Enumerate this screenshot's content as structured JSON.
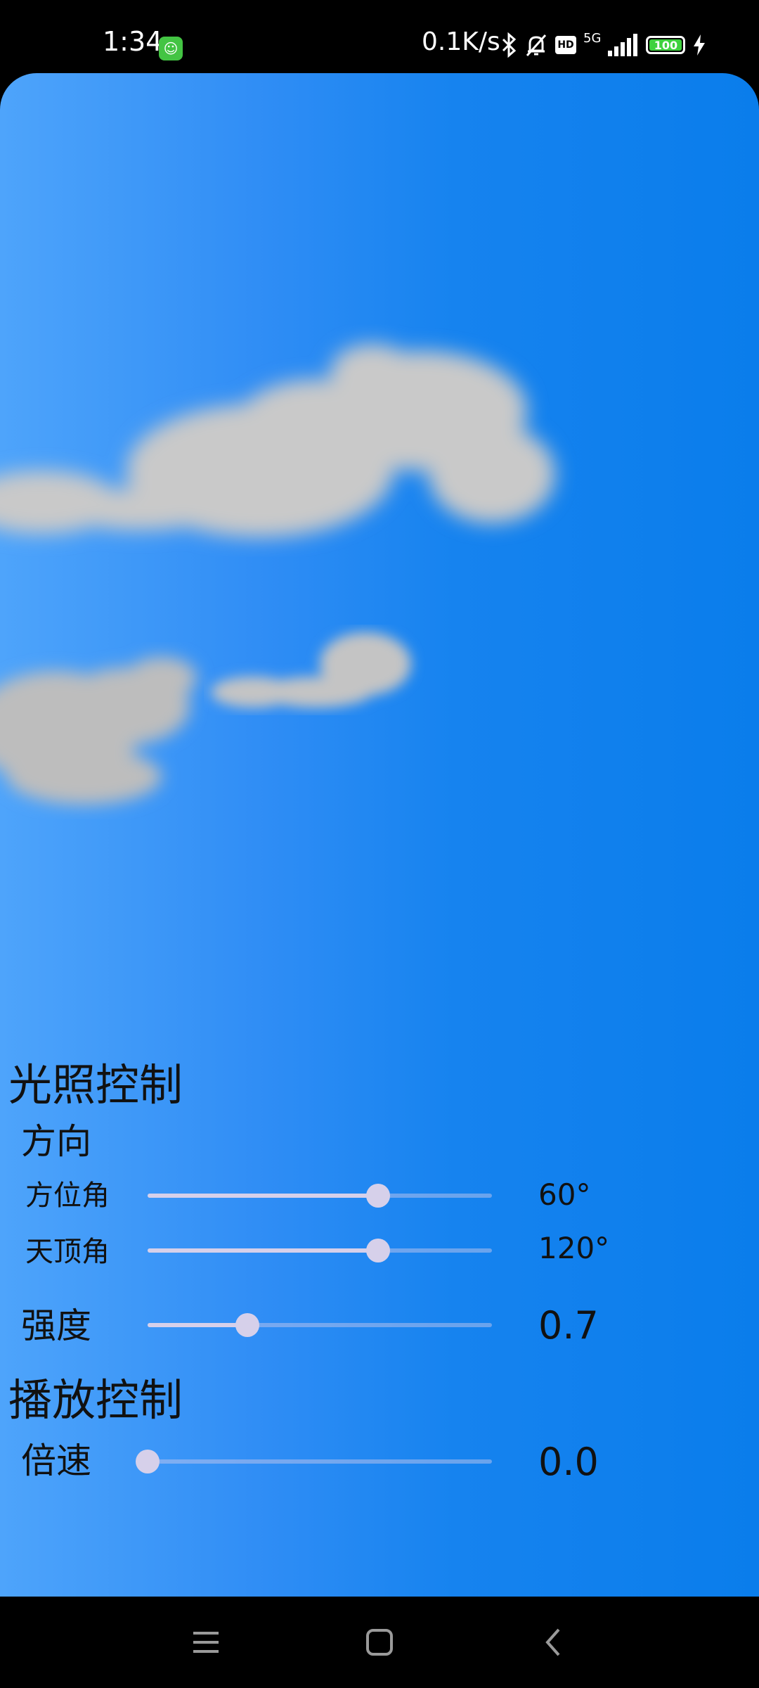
{
  "status_bar": {
    "time": "1:34",
    "net_speed": "0.1K/s",
    "network_type": "5G",
    "hd_label": "HD",
    "battery_level": "100",
    "icons": [
      "app-notification-icon",
      "bluetooth-icon",
      "silent-bell-icon",
      "hd-icon",
      "signal-icon",
      "battery-icon",
      "charging-icon"
    ]
  },
  "controls": {
    "lighting_title": "光照控制",
    "direction_title": "方向",
    "azimuth": {
      "label": "方位角",
      "value_text": "60°",
      "fraction": 0.67
    },
    "zenith": {
      "label": "天顶角",
      "value_text": "120°",
      "fraction": 0.67
    },
    "intensity": {
      "label": "强度",
      "value_text": "0.7",
      "fraction": 0.29
    },
    "playback_title": "播放控制",
    "speed": {
      "label": "倍速",
      "value_text": "0.0",
      "fraction": 0.0
    }
  },
  "nav_bar": {
    "icons": [
      "menu-icon",
      "home-icon",
      "back-icon"
    ]
  },
  "colors": {
    "sky_left": "#4ea4fb",
    "sky_right": "#0a7deb",
    "slider_thumb": "#d6d0ea",
    "text": "#111111"
  }
}
